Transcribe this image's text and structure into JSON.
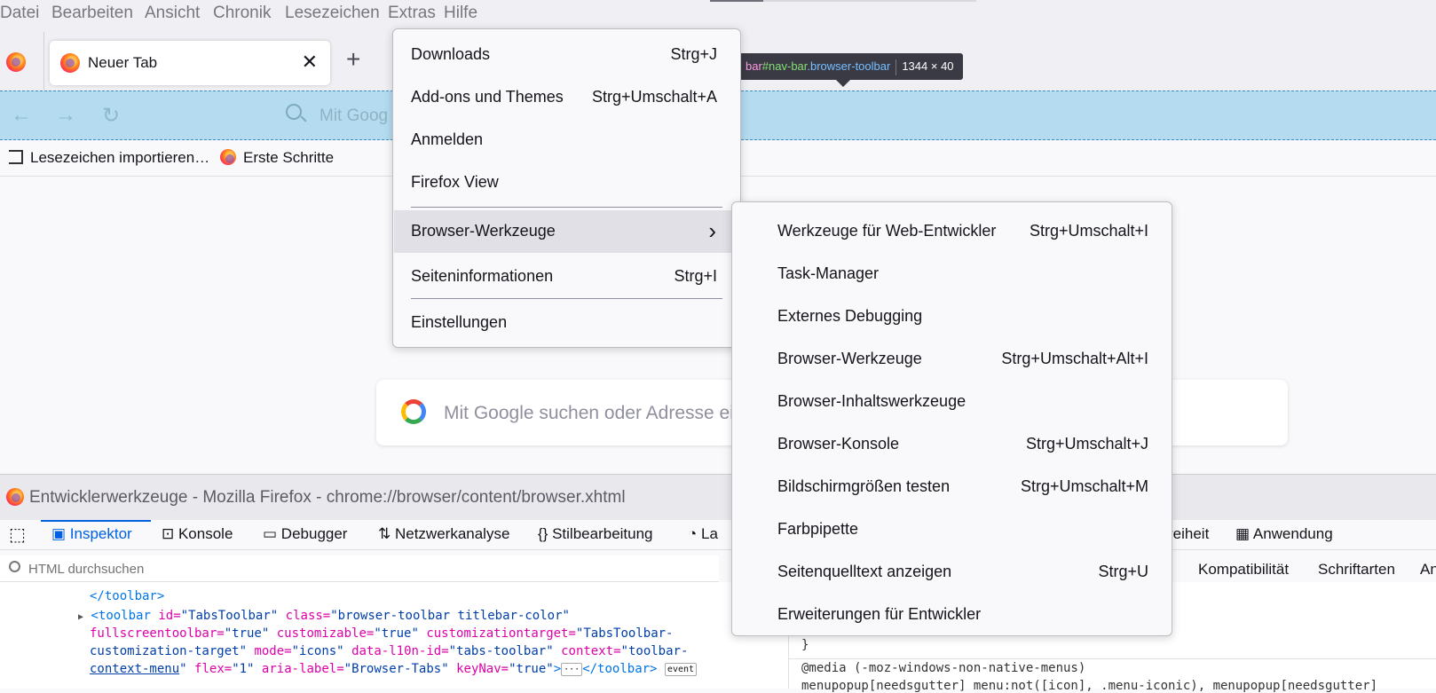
{
  "menubar": {
    "items": [
      "Datei",
      "Bearbeiten",
      "Ansicht",
      "Chronik",
      "Lesezeichen",
      "Extras",
      "Hilfe"
    ]
  },
  "tabbar": {
    "tab_title": "Neuer Tab",
    "close_glyph": "✕",
    "new_tab_glyph": "+"
  },
  "navbar": {
    "back_glyph": "←",
    "forward_glyph": "→",
    "reload_glyph": "↻",
    "url_placeholder": "Mit Goog"
  },
  "tooltip": {
    "part1": "bar",
    "part2": "#nav-bar",
    "part3": ".browser-toolbar",
    "size": "1344 × 40"
  },
  "bookmarks": {
    "import_label": "Lesezeichen importieren…",
    "first_steps_label": "Erste Schritte"
  },
  "content": {
    "search_placeholder": "Mit Google suchen oder Adresse ei"
  },
  "extras_menu": {
    "items": [
      {
        "label": "Downloads",
        "shortcut": "Strg+J"
      },
      {
        "label": "Add-ons und Themes",
        "shortcut": "Strg+Umschalt+A"
      },
      {
        "label": "Anmelden",
        "shortcut": ""
      },
      {
        "label": "Firefox View",
        "shortcut": ""
      },
      {
        "label": "Browser-Werkzeuge",
        "shortcut": "",
        "submenu": true
      },
      {
        "label": "Seiteninformationen",
        "shortcut": "Strg+I"
      },
      {
        "label": "Einstellungen",
        "shortcut": ""
      }
    ],
    "chevron_glyph": "›"
  },
  "tools_submenu": {
    "items": [
      {
        "label": "Werkzeuge für Web-Entwickler",
        "shortcut": "Strg+Umschalt+I"
      },
      {
        "label": "Task-Manager",
        "shortcut": ""
      },
      {
        "label": "Externes Debugging",
        "shortcut": ""
      },
      {
        "label": "Browser-Werkzeuge",
        "shortcut": "Strg+Umschalt+Alt+I"
      },
      {
        "label": "Browser-Inhaltswerkzeuge",
        "shortcut": ""
      },
      {
        "label": "Browser-Konsole",
        "shortcut": "Strg+Umschalt+J"
      },
      {
        "label": "Bildschirmgrößen testen",
        "shortcut": "Strg+Umschalt+M"
      },
      {
        "label": "Farbpipette",
        "shortcut": ""
      },
      {
        "label": "Seitenquelltext anzeigen",
        "shortcut": "Strg+U"
      },
      {
        "label": "Erweiterungen für Entwickler",
        "shortcut": ""
      }
    ]
  },
  "devtools": {
    "window_title": "Entwicklerwerkzeuge - Mozilla Firefox - chrome://browser/content/browser.xhtml",
    "tabs": [
      "Inspektor",
      "Konsole",
      "Debugger",
      "Netzwerkanalyse",
      "Stilbearbeitung",
      "La",
      "reiheit",
      "Anwendung"
    ],
    "search_placeholder": "HTML durchsuchen",
    "side_tabs": [
      "Kompatibilität",
      "Schriftarten",
      "An"
    ],
    "html_lines": {
      "l1": "</toolbar>",
      "l2_tag": "<toolbar",
      "l2_id_attr": "id=",
      "l2_id_val": "\"TabsToolbar\"",
      "l2_class_attr": "class=",
      "l2_class_val": "\"browser-toolbar titlebar-color\"",
      "l3_a1": "fullscreentoolbar=",
      "l3_v1": "\"true\"",
      "l3_a2": "customizable=",
      "l3_v2": "\"true\"",
      "l3_a3": "customizationtarget=",
      "l3_v3": "\"TabsToolbar-",
      "l4_v3": "customization-target\"",
      "l4_a4": "mode=",
      "l4_v4": "\"icons\"",
      "l4_a5": "data-l10n-id=",
      "l4_v5": "\"tabs-toolbar\"",
      "l4_a6": "context=",
      "l4_v6": "\"toolbar-",
      "l5_v6": "context-menu",
      "l5_a7": "flex=",
      "l5_v7": "\"1\"",
      "l5_a8": "aria-label=",
      "l5_v8": "\"Browser-Tabs\"",
      "l5_a9": "keyNav=",
      "l5_v9": "\"true\"",
      "l5_close": "</toolbar>",
      "ellipsis": "···",
      "badge": "event"
    },
    "rules": {
      "r1": "}",
      "r2": "@media (-moz-windows-non-native-menus)",
      "r3": "menupopup[needsgutter] menu:not([icon], .menu-iconic), menupopup[needsgutter]"
    }
  },
  "colors": {
    "highlight": "#b4dbef",
    "accent": "#0061e0"
  }
}
